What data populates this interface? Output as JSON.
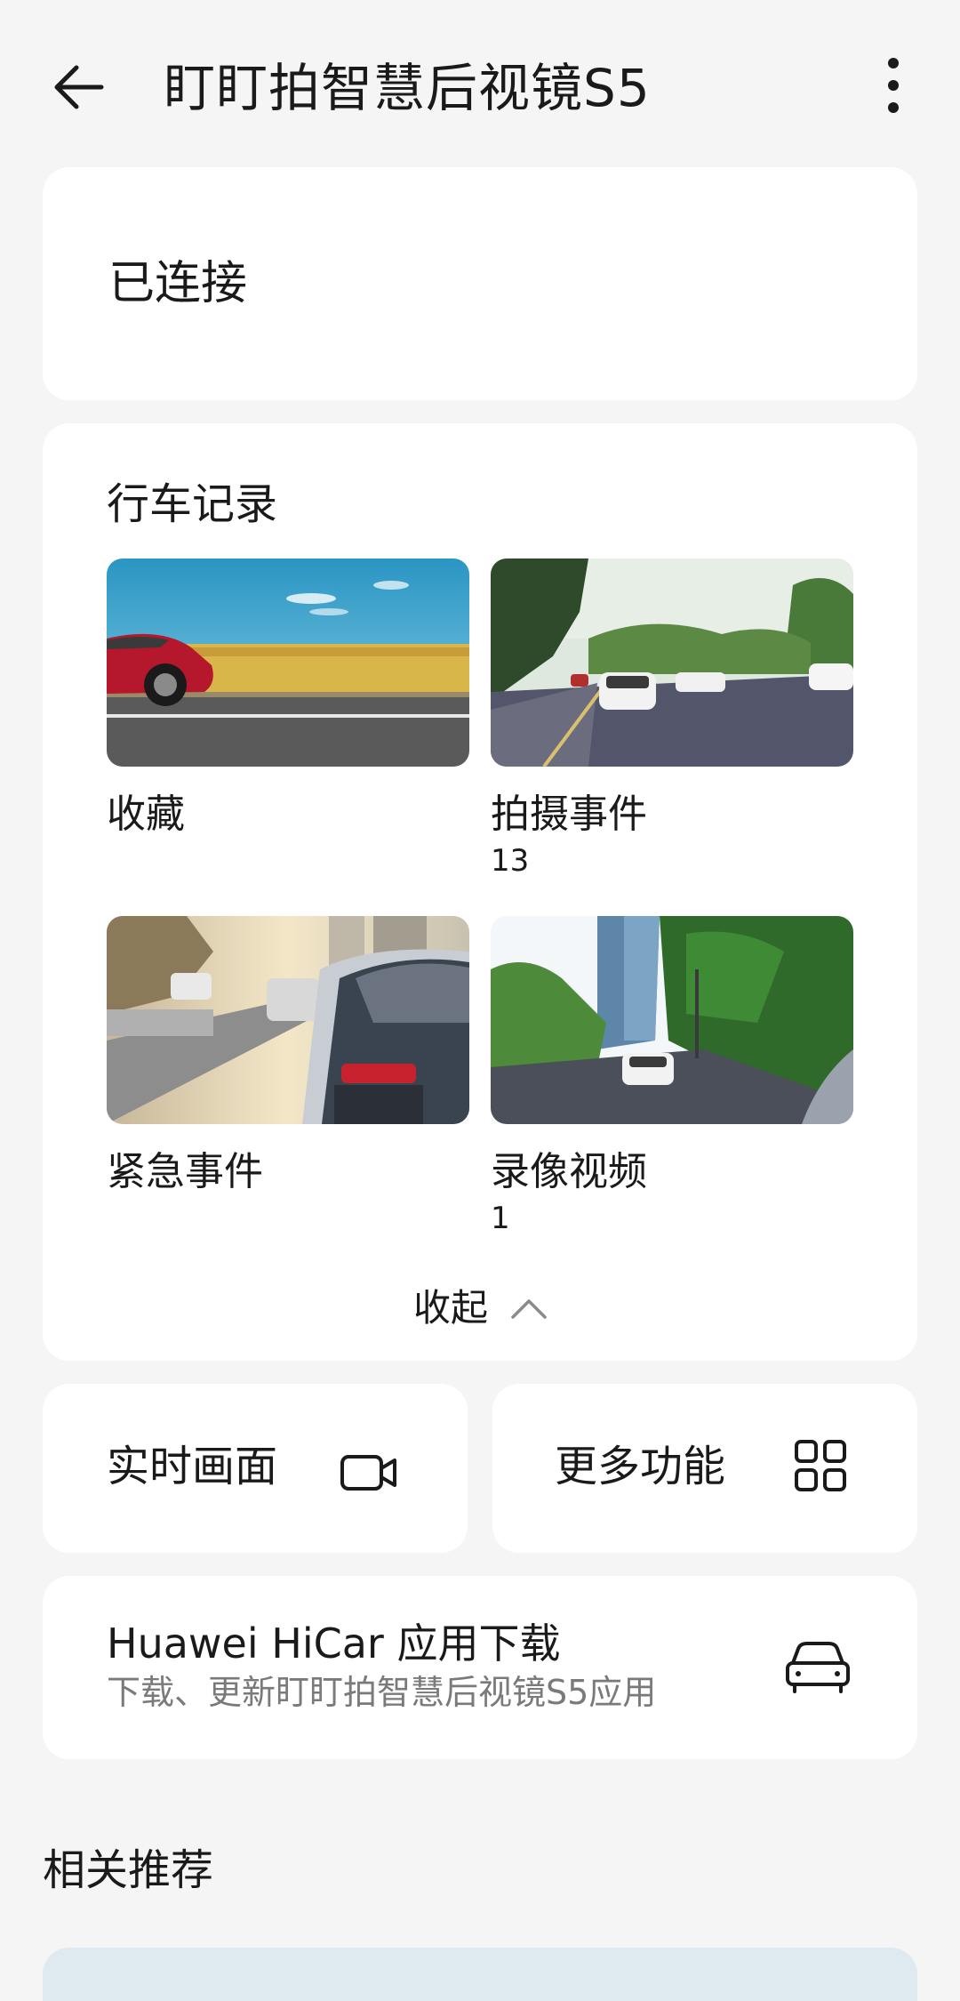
{
  "header": {
    "title": "盯盯拍智慧后视镜S5",
    "back_icon": "arrow-left-icon",
    "more_icon": "more-vertical-icon"
  },
  "status": {
    "text": "已连接"
  },
  "records": {
    "title": "行车记录",
    "items": [
      {
        "label": "收藏",
        "count": "",
        "thumb": "red-car-wheat-field"
      },
      {
        "label": "拍摄事件",
        "count": "13",
        "thumb": "street-white-cars"
      },
      {
        "label": "紧急事件",
        "count": "",
        "thumb": "traffic-jam-sunset"
      },
      {
        "label": "录像视频",
        "count": "1",
        "thumb": "city-tower-road"
      }
    ],
    "collapse_label": "收起",
    "collapse_icon": "chevron-up-icon"
  },
  "live_view": {
    "label": "实时画面",
    "icon": "video-camera-icon"
  },
  "more_functions": {
    "label": "更多功能",
    "icon": "grid-icon"
  },
  "hicar": {
    "title": "Huawei HiCar 应用下载",
    "subtitle": "下载、更新盯盯拍智慧后视镜S5应用",
    "icon": "car-icon"
  },
  "recommendations": {
    "title": "相关推荐"
  },
  "colors": {
    "background": "#f5f5f5",
    "card": "#ffffff",
    "secondary_text": "#7a7a7a"
  }
}
